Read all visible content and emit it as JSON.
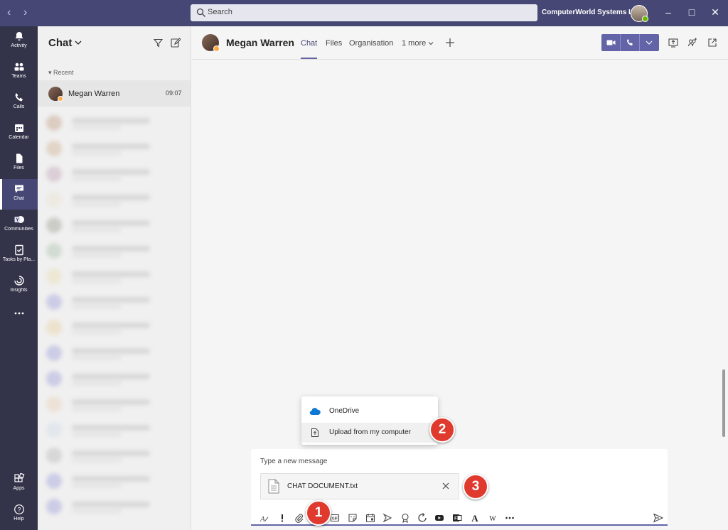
{
  "titlebar": {
    "search_placeholder": "Search",
    "org_name": "ComputerWorld Systems L...",
    "window_controls": [
      "minimize",
      "maximize",
      "close"
    ]
  },
  "rail": {
    "items": [
      {
        "label": "Activity",
        "icon": "bell-icon"
      },
      {
        "label": "Teams",
        "icon": "teams-icon"
      },
      {
        "label": "Calls",
        "icon": "phone-icon"
      },
      {
        "label": "Calendar",
        "icon": "calendar-icon"
      },
      {
        "label": "Files",
        "icon": "file-icon"
      },
      {
        "label": "Chat",
        "icon": "chat-icon",
        "active": true
      },
      {
        "label": "Communities",
        "icon": "communities-icon"
      },
      {
        "label": "Tasks by Pla...",
        "icon": "tasks-icon"
      },
      {
        "label": "Insights",
        "icon": "insights-icon"
      },
      {
        "label": "",
        "icon": "more-icon"
      }
    ],
    "bottom": [
      {
        "label": "Apps",
        "icon": "apps-icon"
      },
      {
        "label": "Help",
        "icon": "help-icon"
      }
    ]
  },
  "chatlist": {
    "title": "Chat",
    "section_label": "Recent",
    "contacts": [
      {
        "name": "Megan Warren",
        "time": "09:07",
        "status": "away"
      }
    ]
  },
  "conversation": {
    "contact_name": "Megan Warren",
    "tabs": [
      "Chat",
      "Files",
      "Organisation",
      "1 more"
    ],
    "active_tab": "Chat"
  },
  "attach_menu": {
    "items": [
      "OneDrive",
      "Upload from my computer"
    ]
  },
  "compose": {
    "placeholder": "Type a new message",
    "attached_file": "CHAT DOCUMENT.txt"
  },
  "callouts": [
    "1",
    "2",
    "3"
  ],
  "colors": {
    "accent": "#6264a7",
    "titlebar": "#464775",
    "rail": "#33344a",
    "callout": "#e03a2f",
    "onedrive": "#0f78d4"
  }
}
